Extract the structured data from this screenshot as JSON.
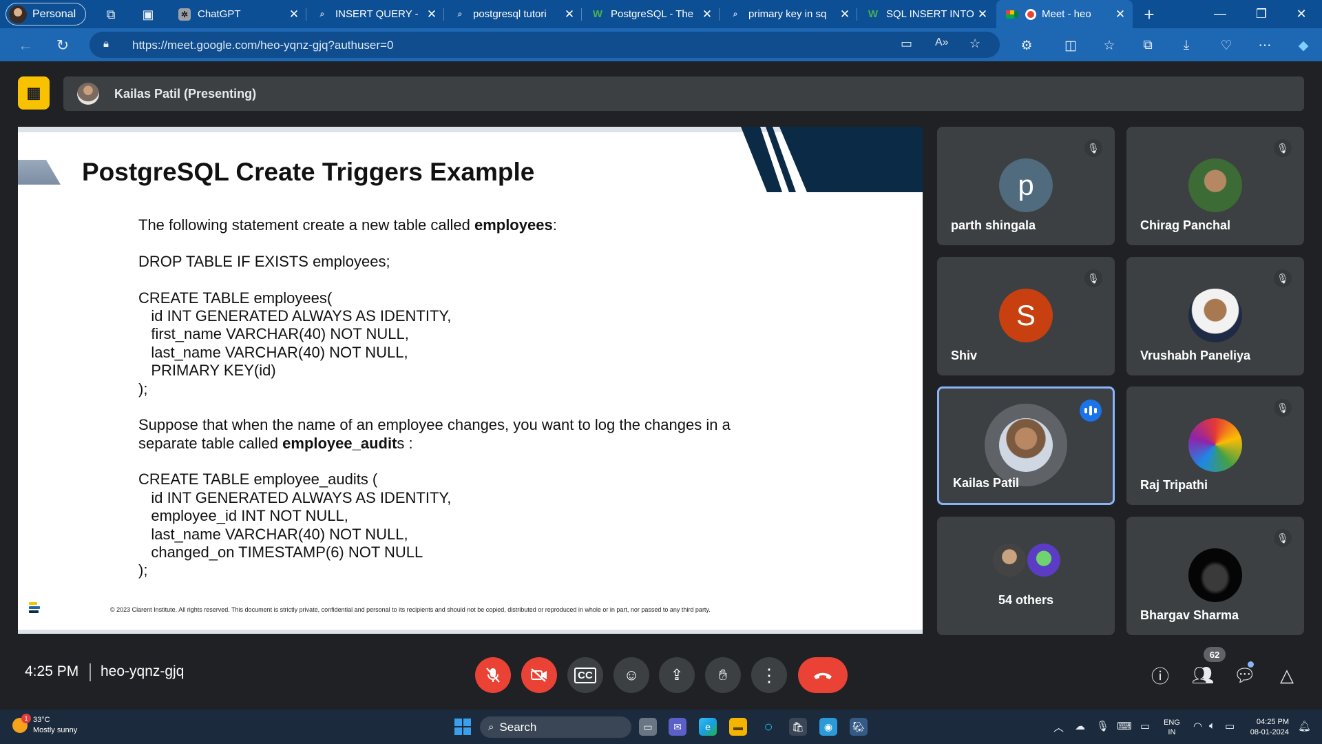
{
  "browser": {
    "profile_label": "Personal",
    "tabs": [
      {
        "title": "ChatGPT",
        "icon": "chatgpt-icon"
      },
      {
        "title": "INSERT QUERY -",
        "icon": "search-icon"
      },
      {
        "title": "postgresql tutori",
        "icon": "search-icon"
      },
      {
        "title": "PostgreSQL - The",
        "icon": "w-icon"
      },
      {
        "title": "primary key in sq",
        "icon": "search-icon"
      },
      {
        "title": "SQL INSERT INTO",
        "icon": "w-icon"
      },
      {
        "title": "Meet - heo",
        "icon": "meet-icon"
      }
    ],
    "url": "https://meet.google.com/heo-yqnz-gjq?authuser=0"
  },
  "meet": {
    "presenter_label": "Kailas Patil (Presenting)",
    "slide": {
      "title": "PostgreSQL Create Triggers Example",
      "intro_prefix": "The following statement create a new table called ",
      "intro_bold": "employees",
      "intro_suffix": ":",
      "drop_stmt": "DROP TABLE IF EXISTS employees;",
      "create1": [
        "CREATE TABLE employees(",
        "   id INT GENERATED ALWAYS AS IDENTITY,",
        "   first_name VARCHAR(40) NOT NULL,",
        "   last_name VARCHAR(40) NOT NULL,",
        "   PRIMARY KEY(id)",
        ");"
      ],
      "suppose_line1": "Suppose that when the name of an employee changes, you want to log the changes in a",
      "suppose_prefix": "separate table called ",
      "suppose_bold": "employee_audit",
      "suppose_suffix": "s :",
      "create2": [
        "CREATE TABLE employee_audits (",
        "   id INT GENERATED ALWAYS AS IDENTITY,",
        "   employee_id INT NOT NULL,",
        "   last_name VARCHAR(40) NOT NULL,",
        "   changed_on TIMESTAMP(6) NOT NULL",
        ");"
      ],
      "footer": "© 2023 Clarent Institute. All rights reserved. This document is strictly private, confidential and personal to its recipients and should not be copied, distributed or reproduced in whole or in part, nor passed to any third party."
    },
    "participants": [
      {
        "name": "parth shingala",
        "initial": "p",
        "muted": true
      },
      {
        "name": "Chirag Panchal",
        "muted": true
      },
      {
        "name": "Shiv",
        "initial": "S",
        "muted": true
      },
      {
        "name": "Vrushabh Paneliya",
        "muted": true
      },
      {
        "name": "Kailas Patil",
        "speaking": true
      },
      {
        "name": "Raj Tripathi",
        "muted": true
      },
      {
        "name": "54 others"
      },
      {
        "name": "Bhargav Sharma",
        "muted": true
      }
    ],
    "time": "4:25 PM",
    "meeting_code": "heo-yqnz-gjq",
    "people_count": "62",
    "colors": {
      "accent_red": "#ea4335",
      "speaking_blue": "#1a73e8",
      "present_yellow": "#f9c200"
    }
  },
  "taskbar": {
    "temperature": "33°C",
    "weather": "Mostly sunny",
    "weather_badge": "1",
    "search_label": "Search",
    "lang1": "ENG",
    "lang2": "IN",
    "time": "04:25 PM",
    "date": "08-01-2024"
  }
}
